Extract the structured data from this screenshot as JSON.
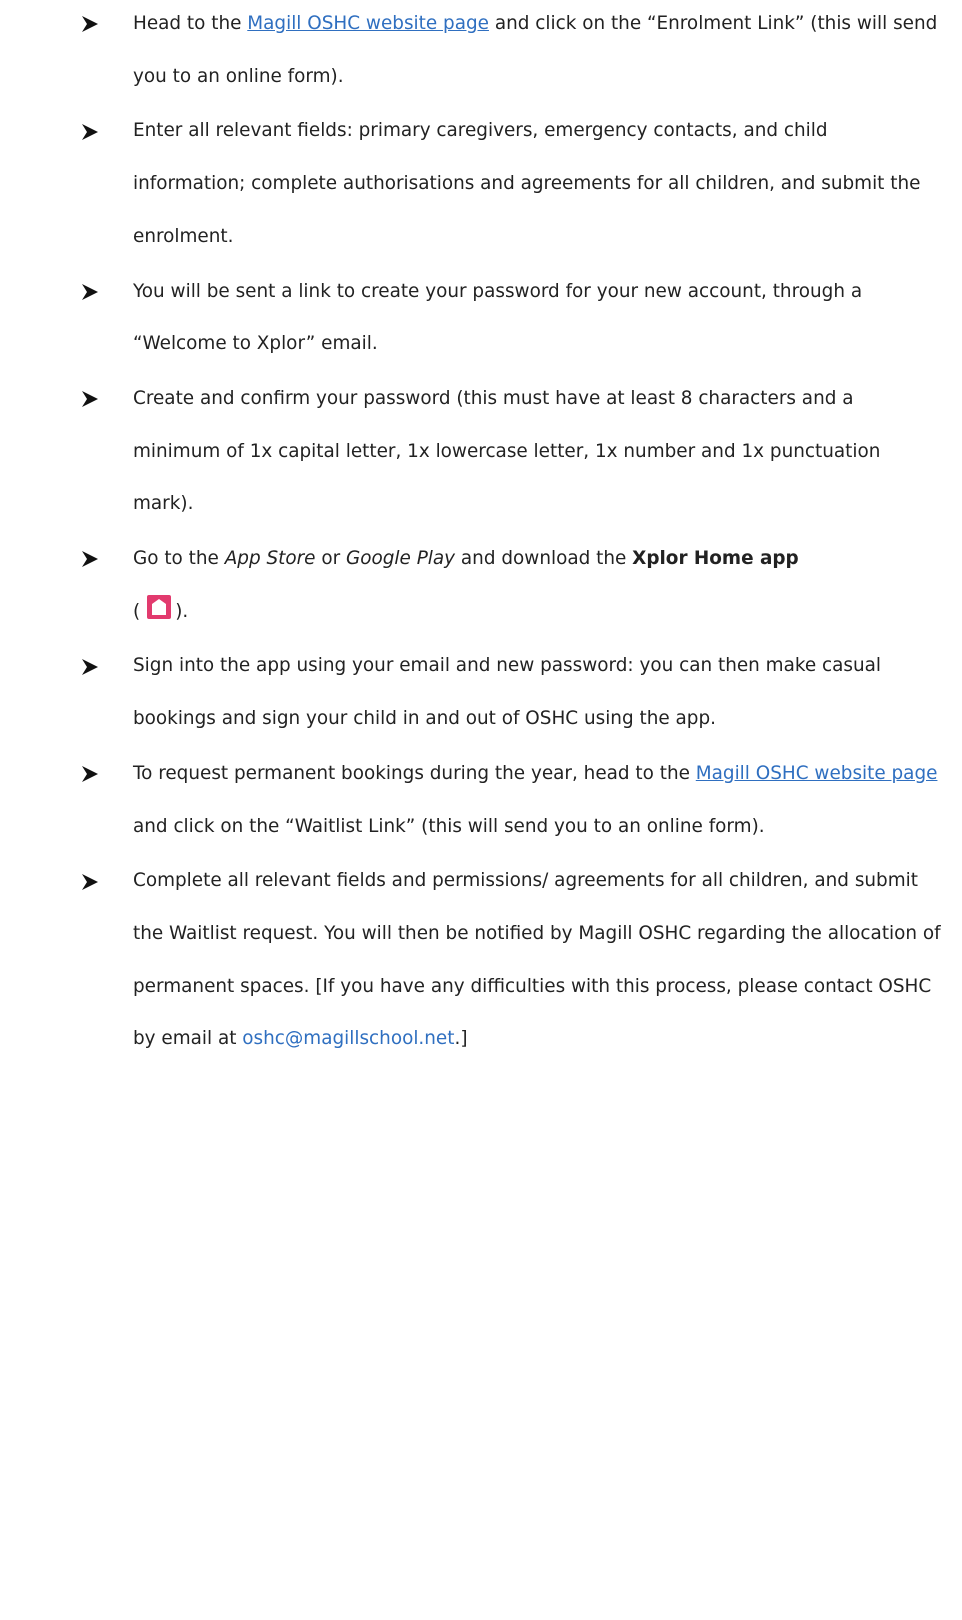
{
  "steps": [
    {
      "before": "Head to the ",
      "link": "Magill OSHC website page",
      "after": " and click on the “Enrolment Link” (this will send you to an online form)."
    },
    {
      "text": "Enter all relevant fields: primary caregivers, emergency contacts, and child information; complete authorisations and agreements for all children, and submit the enrolment."
    },
    {
      "text": "You will be sent a link to create your password for your new account, through a “Welcome to Xplor” email."
    },
    {
      "text": "Create and confirm your password (this must have at least 8 characters and a minimum of 1x capital letter, 1x lowercase letter, 1x number and 1x punctuation mark)."
    },
    {
      "p1": "Go to the ",
      "appstore": "App Store",
      "p2": " or ",
      "googleplay": "Google Play",
      "p3": " and download the ",
      "appname": "Xplor Home app",
      "p4": " (",
      "icon": "xplor-home-app-icon",
      "p5": ")."
    },
    {
      "text": "Sign into the app using your email and new password: you can then make casual bookings and sign your child in and out of OSHC using the app."
    },
    {
      "before": "To request permanent bookings during the year, head to the ",
      "link": "Magill OSHC website page",
      "after": " and click on the “Waitlist Link” (this will send you to an online form)."
    },
    {
      "before": "Complete all relevant fields and permissions/ agreements for all children, and submit the Waitlist request. You will then be notified by Magill OSHC regarding the allocation of permanent spaces. [If you have any difficulties with this process, please contact OSHC by email at ",
      "email": "oshc@magillschool.net",
      "after": ".]"
    }
  ],
  "colors": {
    "link": "#2f6fc0",
    "app_icon": "#e23a6e"
  },
  "bullet_icon": "arrowhead-bullet-icon"
}
